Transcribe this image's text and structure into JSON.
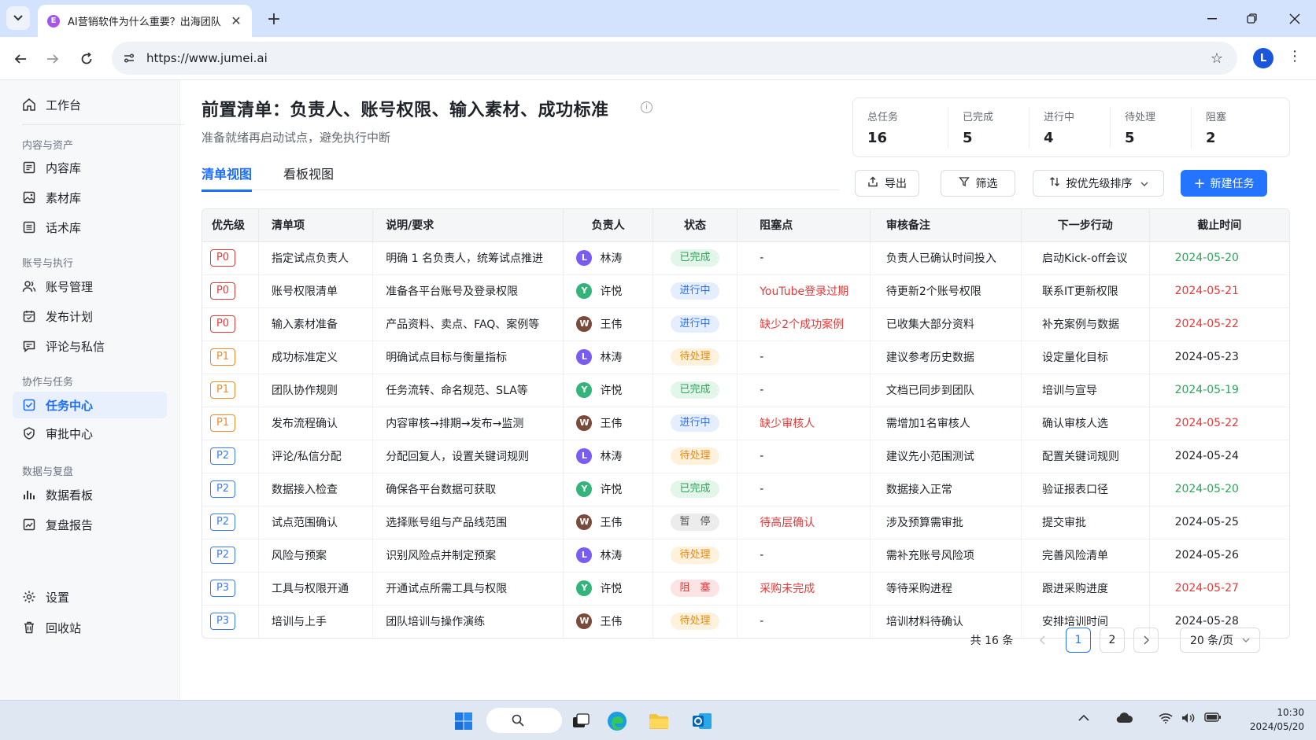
{
  "browser": {
    "tab_title": "AI营销软件为什么重要？出海团队",
    "favicon_letter": "E",
    "url": "https://www.jumei.ai",
    "profile_initial": "L"
  },
  "sidebar": {
    "top_item": "工作台",
    "groups": [
      {
        "title": "内容与资产",
        "items": [
          "内容库",
          "素材库",
          "话术库"
        ]
      },
      {
        "title": "账号与执行",
        "items": [
          "账号管理",
          "发布计划",
          "评论与私信"
        ]
      },
      {
        "title": "协作与任务",
        "items": [
          "任务中心",
          "审批中心"
        ]
      },
      {
        "title": "数据与复盘",
        "items": [
          "数据看板",
          "复盘报告"
        ]
      }
    ],
    "active_item": "任务中心",
    "bottom_items": [
      "设置",
      "回收站"
    ]
  },
  "page": {
    "title": "前置清单：负责人、账号权限、输入素材、成功标准",
    "subtitle": "准备就绪再启动试点，避免执行中断"
  },
  "stats": [
    {
      "label": "总任务",
      "value": "16"
    },
    {
      "label": "已完成",
      "value": "5"
    },
    {
      "label": "进行中",
      "value": "4"
    },
    {
      "label": "待处理",
      "value": "5"
    },
    {
      "label": "阻塞",
      "value": "2"
    }
  ],
  "views": {
    "list": "清单视图",
    "board": "看板视图",
    "active": "清单视图"
  },
  "actions": {
    "export": "导出",
    "filter": "筛选",
    "sort": "按优先级排序",
    "new_task": "新建任务"
  },
  "table": {
    "headers": [
      "优先级",
      "清单项",
      "说明/要求",
      "负责人",
      "状态",
      "阻塞点",
      "审核备注",
      "下一步行动",
      "截止时间"
    ],
    "rows": [
      {
        "priority": "P0",
        "item": "指定试点负责人",
        "desc": "明确 1 名负责人，统筹试点推进",
        "owner": "林涛",
        "owner_initial": "L",
        "status": "已完成",
        "blocker": "-",
        "note": "负责人已确认时间投入",
        "next": "启动Kick-off会议",
        "due": "2024-05-20",
        "due_color": "green"
      },
      {
        "priority": "P0",
        "item": "账号权限清单",
        "desc": "准备各平台账号及登录权限",
        "owner": "许悦",
        "owner_initial": "Y",
        "status": "进行中",
        "blocker": "YouTube登录过期",
        "note": "待更新2个账号权限",
        "next": "联系IT更新权限",
        "due": "2024-05-21",
        "due_color": "red"
      },
      {
        "priority": "P0",
        "item": "输入素材准备",
        "desc": "产品资料、卖点、FAQ、案例等",
        "owner": "王伟",
        "owner_initial": "W",
        "status": "进行中",
        "blocker": "缺少2个成功案例",
        "note": "已收集大部分资料",
        "next": "补充案例与数据",
        "due": "2024-05-22",
        "due_color": "red"
      },
      {
        "priority": "P1",
        "item": "成功标准定义",
        "desc": "明确试点目标与衡量指标",
        "owner": "林涛",
        "owner_initial": "L",
        "status": "待处理",
        "blocker": "-",
        "note": "建议参考历史数据",
        "next": "设定量化目标",
        "due": "2024-05-23",
        "due_color": "normal"
      },
      {
        "priority": "P1",
        "item": "团队协作规则",
        "desc": "任务流转、命名规范、SLA等",
        "owner": "许悦",
        "owner_initial": "Y",
        "status": "已完成",
        "blocker": "-",
        "note": "文档已同步到团队",
        "next": "培训与宣导",
        "due": "2024-05-19",
        "due_color": "green"
      },
      {
        "priority": "P1",
        "item": "发布流程确认",
        "desc": "内容审核→排期→发布→监测",
        "owner": "王伟",
        "owner_initial": "W",
        "status": "进行中",
        "blocker": "缺少审核人",
        "note": "需增加1名审核人",
        "next": "确认审核人选",
        "due": "2024-05-22",
        "due_color": "red"
      },
      {
        "priority": "P2",
        "item": "评论/私信分配",
        "desc": "分配回复人，设置关键词规则",
        "owner": "林涛",
        "owner_initial": "L",
        "status": "待处理",
        "blocker": "-",
        "note": "建议先小范围测试",
        "next": "配置关键词规则",
        "due": "2024-05-24",
        "due_color": "normal"
      },
      {
        "priority": "P2",
        "item": "数据接入检查",
        "desc": "确保各平台数据可获取",
        "owner": "许悦",
        "owner_initial": "Y",
        "status": "已完成",
        "blocker": "-",
        "note": "数据接入正常",
        "next": "验证报表口径",
        "due": "2024-05-20",
        "due_color": "green"
      },
      {
        "priority": "P2",
        "item": "试点范围确认",
        "desc": "选择账号组与产品线范围",
        "owner": "王伟",
        "owner_initial": "W",
        "status": "暂　停",
        "blocker": "待高层确认",
        "note": "涉及预算需审批",
        "next": "提交审批",
        "due": "2024-05-25",
        "due_color": "normal"
      },
      {
        "priority": "P2",
        "item": "风险与预案",
        "desc": "识别风险点并制定预案",
        "owner": "林涛",
        "owner_initial": "L",
        "status": "待处理",
        "blocker": "-",
        "note": "需补充账号风险项",
        "next": "完善风险清单",
        "due": "2024-05-26",
        "due_color": "normal"
      },
      {
        "priority": "P3",
        "item": "工具与权限开通",
        "desc": "开通试点所需工具与权限",
        "owner": "许悦",
        "owner_initial": "Y",
        "status": "阻　塞",
        "blocker": "采购未完成",
        "note": "等待采购进程",
        "next": "跟进采购进度",
        "due": "2024-05-27",
        "due_color": "red"
      },
      {
        "priority": "P3",
        "item": "培训与上手",
        "desc": "团队培训与操作演练",
        "owner": "王伟",
        "owner_initial": "W",
        "status": "待处理",
        "blocker": "-",
        "note": "培训材料待确认",
        "next": "安排培训时间",
        "due": "2024-05-28",
        "due_color": "normal"
      }
    ]
  },
  "pagination": {
    "total": "共 16 条",
    "pages": [
      "1",
      "2"
    ],
    "current": "1",
    "page_size": "20 条/页"
  },
  "taskbar": {
    "time": "10:30",
    "date": "2024/05/20"
  },
  "colors": {
    "primary": "#2474ff",
    "P0": "#e23a3a",
    "P1": "#f08a24",
    "P2": "#3a7bff",
    "P3": "#3a7bff",
    "avatar_L": "#7b5cf0",
    "avatar_Y": "#34b37a",
    "avatar_W": "#7a4a3a"
  }
}
